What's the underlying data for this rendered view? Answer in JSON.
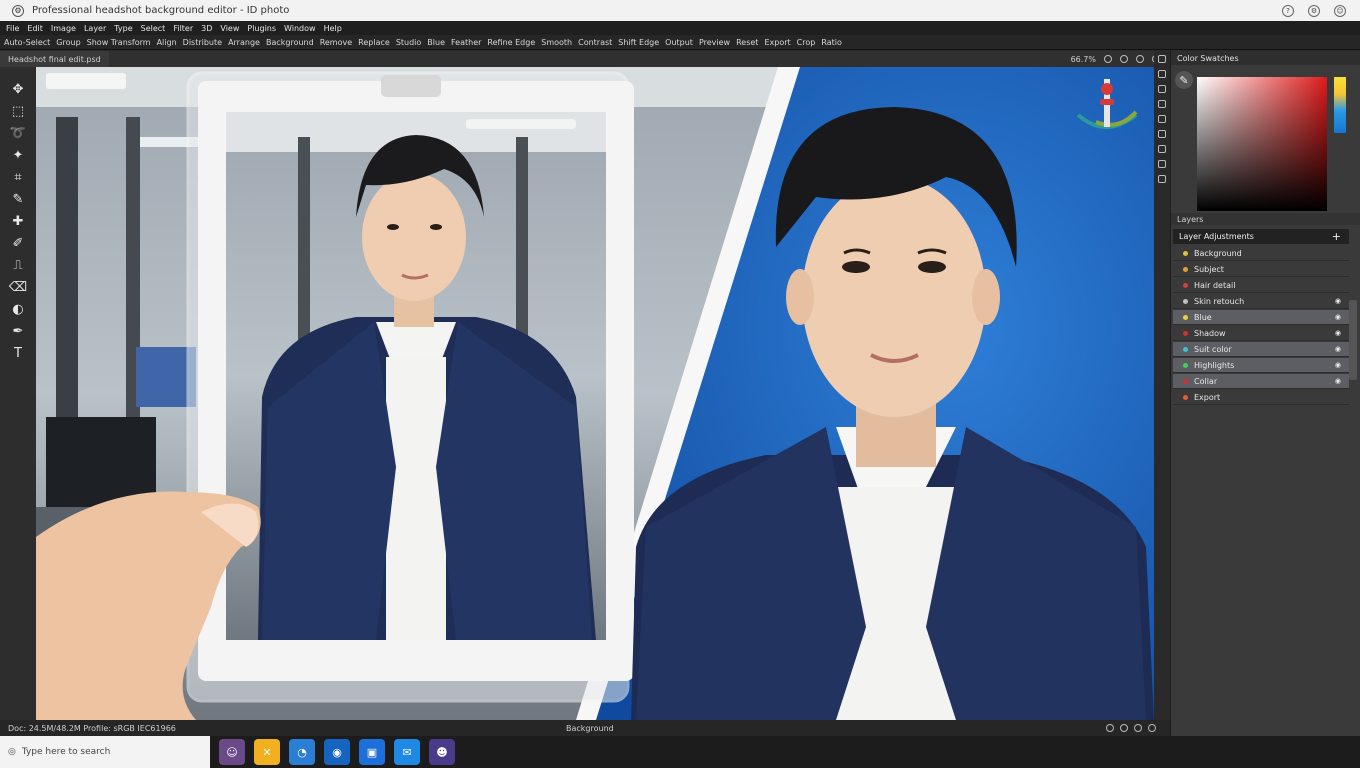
{
  "window": {
    "title": "Professional headshot background editor - ID photo",
    "controls": [
      "help",
      "settings",
      "user"
    ]
  },
  "menu": {
    "items": [
      "File",
      "Edit",
      "Image",
      "Layer",
      "Type",
      "Select",
      "Filter",
      "3D",
      "View",
      "Plugins",
      "Window",
      "Help"
    ]
  },
  "options": {
    "items": [
      "Auto-Select",
      "Group",
      "Show Transform",
      "Align",
      "Distribute",
      "Arrange",
      "Background",
      "Remove",
      "Replace",
      "Studio",
      "Blue",
      "Feather",
      "Refine Edge",
      "Smooth",
      "Contrast",
      "Shift Edge",
      "Output",
      "Preview",
      "Reset",
      "Export",
      "Crop",
      "Ratio"
    ]
  },
  "document": {
    "tab_label": "Headshot final edit.psd",
    "zoom_label": "66.7%"
  },
  "tools": [
    {
      "name": "move-tool",
      "glyph": "✥"
    },
    {
      "name": "marquee-tool",
      "glyph": "⬚"
    },
    {
      "name": "lasso-tool",
      "glyph": "➰"
    },
    {
      "name": "magic-wand-tool",
      "glyph": "✦"
    },
    {
      "name": "crop-tool",
      "glyph": "⌗"
    },
    {
      "name": "eyedropper-tool",
      "glyph": "✎"
    },
    {
      "name": "healing-tool",
      "glyph": "✚"
    },
    {
      "name": "brush-tool",
      "glyph": "✐"
    },
    {
      "name": "stamp-tool",
      "glyph": "⎍"
    },
    {
      "name": "eraser-tool",
      "glyph": "⌫"
    },
    {
      "name": "gradient-tool",
      "glyph": "◐"
    },
    {
      "name": "pen-tool",
      "glyph": "✒"
    },
    {
      "name": "text-tool",
      "glyph": "T"
    }
  ],
  "panel": {
    "color_title": "Color Swatches",
    "layers_section": "Layers",
    "layers_title": "Layer Adjustments",
    "layers": [
      {
        "label": "Background",
        "color": "#e0c040",
        "selected": false,
        "visible": false
      },
      {
        "label": "Subject",
        "color": "#e0a030",
        "selected": false,
        "visible": false
      },
      {
        "label": "Hair detail",
        "color": "#d24040",
        "selected": false,
        "visible": false
      },
      {
        "label": "Skin retouch",
        "color": "#c0c0c0",
        "selected": false,
        "visible": true
      },
      {
        "label": "Blue",
        "color": "#e8d040",
        "selected": true,
        "visible": true
      },
      {
        "label": "Shadow",
        "color": "#d03030",
        "selected": false,
        "visible": true
      },
      {
        "label": "Suit color",
        "color": "#40c0d0",
        "selected": true,
        "visible": true
      },
      {
        "label": "Highlights",
        "color": "#40d060",
        "selected": true,
        "visible": true
      },
      {
        "label": "Collar",
        "color": "#d03030",
        "selected": true,
        "visible": true
      },
      {
        "label": "Export",
        "color": "#e06030",
        "selected": false,
        "visible": false
      }
    ]
  },
  "status": {
    "left": "Doc: 24.5M/48.2M Profile: sRGB IEC61966",
    "center": "Background"
  },
  "taskbar": {
    "search_placeholder": "Type here to search",
    "apps": [
      {
        "name": "photo-app",
        "color": "#6b4a8a",
        "glyph": "☺"
      },
      {
        "name": "tools-app",
        "color": "#f0b020",
        "glyph": "✕"
      },
      {
        "name": "browser-app",
        "color": "#2a7fd4",
        "glyph": "◔"
      },
      {
        "name": "camera-app",
        "color": "#1565c0",
        "glyph": "◉"
      },
      {
        "name": "gallery-app",
        "color": "#1e6fd9",
        "glyph": "▣"
      },
      {
        "name": "chat-app",
        "color": "#1e88e5",
        "glyph": "✉"
      },
      {
        "name": "profile-app",
        "color": "#4a3a8a",
        "glyph": "☻"
      }
    ]
  }
}
